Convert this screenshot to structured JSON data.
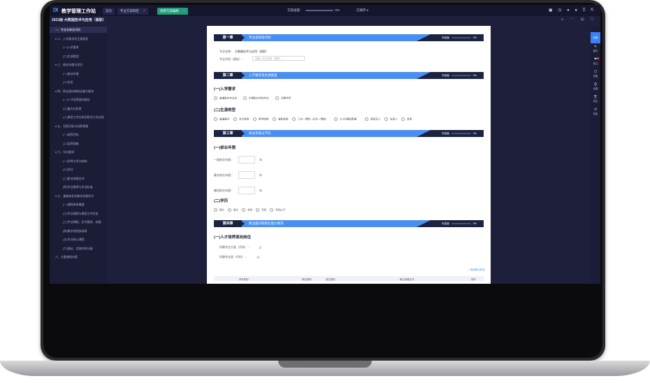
{
  "app": {
    "logo_mark": "IX",
    "title": "教学管理工作站"
  },
  "tabs": [
    {
      "label": "首页",
      "active": false
    },
    {
      "label": "专业方案制定",
      "active": false,
      "close": "×"
    },
    {
      "label": "培养方案编制",
      "active": true,
      "close": "×"
    }
  ],
  "top": {
    "progress_label": "方案进度：",
    "progress_value": "0%",
    "progress": 0,
    "status": "已保存 ▾",
    "icons": "▣ ◷ ● ● ⍰ ⇱"
  },
  "doc_title": "2022级·大数据技术与应用（高职）",
  "sub_icons": "⌂ ⋯ ◎ ⛶",
  "sidebar": [
    {
      "label": "一、专业名称及代码",
      "level": 1,
      "hl": true
    },
    {
      "label": "▾ 二、入学要求及生源类型",
      "level": 1,
      "hl": false
    },
    {
      "label": "(一)入学要求",
      "level": 2,
      "hl": false
    },
    {
      "label": "(二)生源类型",
      "level": 2,
      "hl": false
    },
    {
      "label": "▾ 三、修业年限与学历",
      "level": 1,
      "hl": false
    },
    {
      "label": "(一)修业年限",
      "level": 2,
      "hl": false
    },
    {
      "label": "(二)学历",
      "level": 2,
      "hl": false
    },
    {
      "label": "▾ 四、职业面向和职业能力要求",
      "level": 1,
      "hl": false
    },
    {
      "label": "(一)人才培养面向岗位",
      "level": 2,
      "hl": false
    },
    {
      "label": "(二)能力分析表",
      "level": 2,
      "hl": false
    },
    {
      "label": "(三)典型工作任务及职业工作过程",
      "level": 2,
      "hl": false
    },
    {
      "label": "▾ 五、培养目标与培养规格",
      "level": 1,
      "hl": false
    },
    {
      "label": "(一)培养目标",
      "level": 2,
      "hl": false
    },
    {
      "label": "(二)培养规格",
      "level": 2,
      "hl": false
    },
    {
      "label": "▾ 六、毕业要求",
      "level": 1,
      "hl": false
    },
    {
      "label": "(一)学时与学分结构",
      "level": 2,
      "hl": false
    },
    {
      "label": "(二)学分",
      "level": 2,
      "hl": false
    },
    {
      "label": "(三)职业资格证书",
      "level": 2,
      "hl": false
    },
    {
      "label": "(四)专业素养与毕业标准",
      "level": 2,
      "hl": false
    },
    {
      "label": "▾ 七、课程体系及教学实践环节",
      "level": 1,
      "hl": false
    },
    {
      "label": "(一)课程体系概要",
      "level": 2,
      "hl": false
    },
    {
      "label": "(二)专业课程与典型工作任务",
      "level": 2,
      "hl": false
    },
    {
      "label": "(三)专业课程、证书要求、技能",
      "level": 2,
      "hl": false
    },
    {
      "label": "(四)教学进程安排表",
      "level": 2,
      "hl": false
    },
    {
      "label": "(五)专业核心课程",
      "level": 2,
      "hl": false
    },
    {
      "label": "(六)理论、实践学时分配",
      "level": 2,
      "hl": false
    },
    {
      "label": "八、主要课程内容",
      "level": 1,
      "hl": false
    }
  ],
  "chapters": [
    {
      "num": "第一章",
      "title": "专业名称及代码",
      "prog_label": "完成度",
      "prog_value": "0%"
    },
    {
      "num": "第二章",
      "title": "入学要求及生源类型",
      "prog_label": "完成度",
      "prog_value": "0%"
    },
    {
      "num": "第三章",
      "title": "修业年限与学历",
      "prog_label": "完成度",
      "prog_value": "0%"
    },
    {
      "num": "第四章",
      "title": "职业面向和职业能力要求",
      "prog_label": "完成度",
      "prog_value": "0%"
    }
  ],
  "ch1": {
    "major_name_label": "专业名称：",
    "major_name_value": "大数据技术与应用（高职）",
    "major_code_label": "专业代码（国标）：",
    "major_code_placeholder": "请输入专业代码（国标）"
  },
  "ch2": {
    "sec1": "(一)入学要求",
    "requirements": [
      "普通高中毕业生",
      "中等职业学校毕业",
      "同等学历"
    ],
    "sec2": "(二)生源类型",
    "sources": [
      "普通高中",
      "对口单招",
      "新学徒制",
      "高职单招",
      "三年一贯制（五年一贯制）",
      "3+2中高职贯通",
      "退役军人",
      "农民工",
      "其他"
    ]
  },
  "ch3": {
    "sec1": "(一)修业年限",
    "years": [
      {
        "label": "一般修业年限：",
        "unit": "年"
      },
      {
        "label": "最长修业年限：",
        "unit": "年"
      },
      {
        "label": "最短修业年限：",
        "unit": "年"
      }
    ],
    "sec2": "(二)学历",
    "degrees": [
      "博士",
      "硕士",
      "本科",
      "专科",
      "专科以下"
    ]
  },
  "ch4": {
    "sec1": "(一)人才培养面向岗位",
    "fields": [
      {
        "label": "所属专业大类（代码）：",
        "value": "()"
      },
      {
        "label": "所属专业类（代码）：",
        "value": "()"
      }
    ],
    "add_link": "+ 添加职业岗位",
    "table_headers": [
      "序号类别",
      "职业类别",
      "岗位类别",
      "职业资格证书",
      "操作"
    ]
  },
  "rail": [
    {
      "icon": "≡",
      "label": "目录",
      "active": true
    },
    {
      "icon": "✎",
      "label": "编写",
      "active": false
    },
    {
      "icon": "⚑",
      "label": "批注",
      "active": false,
      "badge": true
    },
    {
      "icon": "⬡",
      "label": "进度",
      "active": false
    },
    {
      "icon": "⛭",
      "label": "设置",
      "active": false
    },
    {
      "icon": "⎘",
      "label": "导出",
      "active": false
    },
    {
      "icon": "↺",
      "label": "恢复",
      "active": false
    }
  ]
}
